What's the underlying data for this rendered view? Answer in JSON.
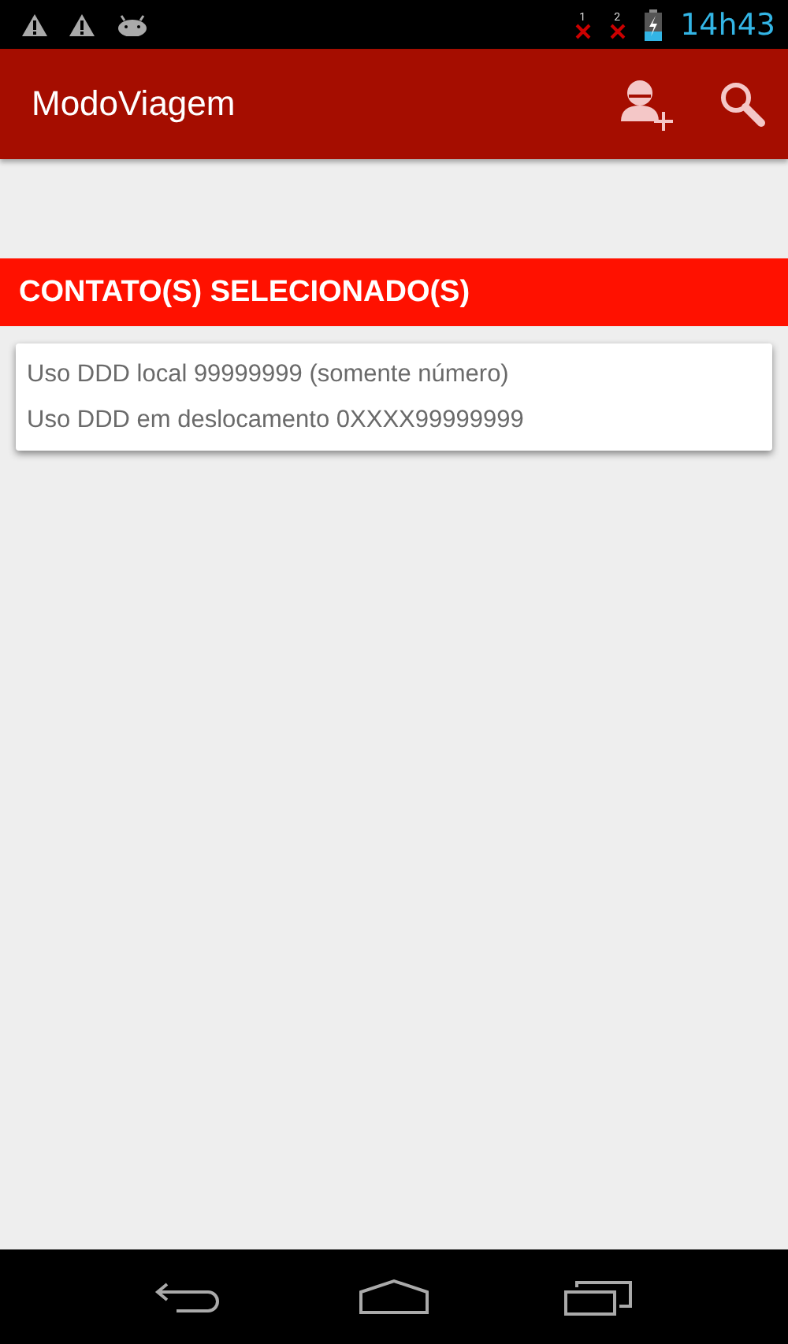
{
  "status_bar": {
    "sim_slots": [
      "1",
      "2"
    ],
    "time": "14h43"
  },
  "app_bar": {
    "title": "ModoViagem"
  },
  "section": {
    "title": "CONTATO(S) SELECIONADO(S)"
  },
  "menu": {
    "items": [
      "Uso DDD local 99999999 (somente número)",
      "Uso DDD em deslocamento 0XXXX99999999"
    ]
  }
}
